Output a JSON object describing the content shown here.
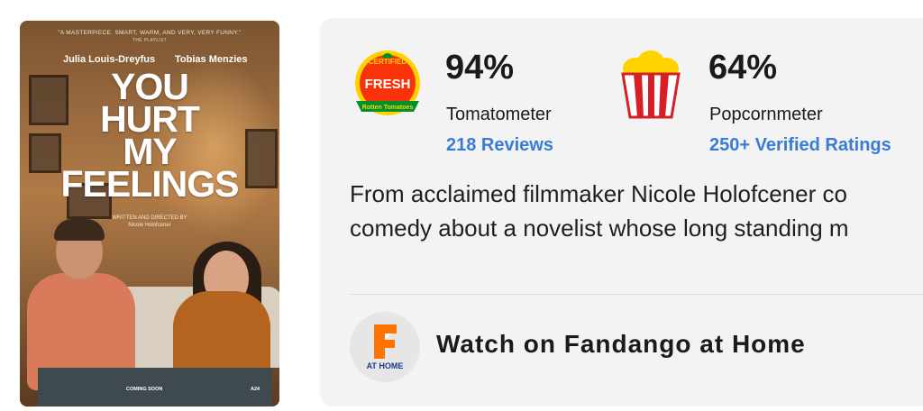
{
  "poster": {
    "quote": "\"A MASTERPIECE. SMART, WARM, AND VERY, VERY FUNNY.\"",
    "quote_source": "THE PLAYLIST",
    "actor_left": "Julia Louis-Dreyfus",
    "actor_right": "Tobias Menzies",
    "title_line1": "YOU",
    "title_line2": "HURT",
    "title_line3": "MY",
    "title_line4": "FEELINGS",
    "director_line1": "WRITTEN AND DIRECTED BY",
    "director_line2": "Nicole Holofcener",
    "coming_soon": "COMING SOON",
    "studio": "A24"
  },
  "tomatometer": {
    "badge_top": "CERTIFIED",
    "badge_middle": "FRESH",
    "badge_bottom": "Rotten Tomatoes",
    "score": "94%",
    "label": "Tomatometer",
    "reviews_link": "218 Reviews"
  },
  "popcornmeter": {
    "score": "64%",
    "label": "Popcornmeter",
    "ratings_link": "250+ Verified Ratings"
  },
  "synopsis": {
    "line1": "From acclaimed filmmaker Nicole Holofcener co",
    "line2": "comedy about a novelist whose long standing m"
  },
  "watch": {
    "badge_text": "AT HOME",
    "label": "Watch on Fandango at Home"
  },
  "colors": {
    "link": "#3a7bd5",
    "card_bg": "#f3f3f3",
    "fandango_orange": "#ff7300",
    "tomato_red": "#fa320a",
    "popcorn_red": "#d91f26"
  }
}
